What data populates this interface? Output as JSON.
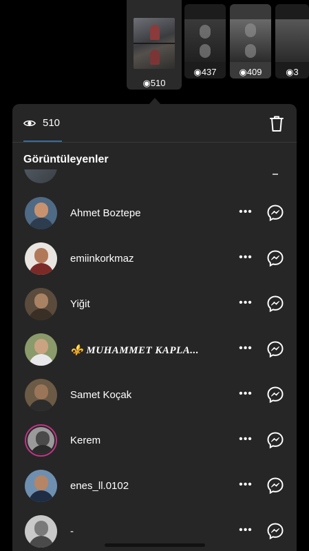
{
  "stories": [
    {
      "views": "510",
      "selected": true
    },
    {
      "views": "437"
    },
    {
      "views": "409"
    },
    {
      "views": "3"
    }
  ],
  "panel": {
    "view_count": "510",
    "section_title": "Görüntüleyenler",
    "icons": {
      "views": "eye-icon",
      "delete": "trash-icon",
      "more": "more-horizontal-icon",
      "message": "messenger-icon"
    },
    "accent_color": "#3a6b9e"
  },
  "viewers": [
    {
      "name": "Ahmet Boztepe"
    },
    {
      "name": "emiinkorkmaz"
    },
    {
      "name": "Yiğit"
    },
    {
      "name": "⚜️ MUHAMMET KAPLA..."
    },
    {
      "name": "Samet Koçak"
    },
    {
      "name": "Kerem",
      "story_ring": true
    },
    {
      "name": "enes_ll.0102"
    },
    {
      "name": "-"
    }
  ],
  "more_glyph": "•••"
}
